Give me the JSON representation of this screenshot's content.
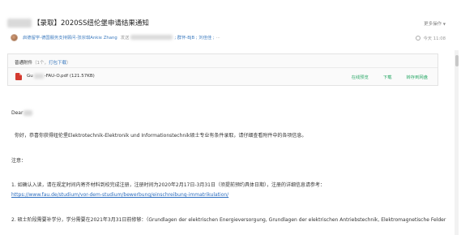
{
  "email": {
    "subject": "【录取】2020SS纽伦堡申请结果通知",
    "more_label": "更多操作",
    "sender_name": "启德留学-德国服务支持顾问-张宗琪Ankie Zhang",
    "to_label": "发送",
    "recipients_visible": "; 群怀-BJB ; 刘佳佳 ;",
    "recipients_more": "...",
    "date": "今天 11:08"
  },
  "attachments": {
    "title": "普通附件",
    "count_text": "（1个，",
    "open_all": "打包下载",
    "count_close": "）",
    "file_prefix": "Gu",
    "file_suffix": "-FAU-O.pdf (121.57KB)",
    "actions": [
      "在线预览",
      "下载",
      "转存到网盘"
    ]
  },
  "body": {
    "greeting": "Dear",
    "para1": "你好，恭喜你获得纽伦堡Elektrotechnik-Elektronik und Informationstechnik硕士专业有条件录取，请仔细查看附件中的各项信息。",
    "para2": "注意：",
    "para3": "1. 如确认入读，请在规定时间内寄齐材料到校完成注册，注册时间为2020年2月17日-3月31日（须提前预约具体日期），注册的详细信息请参考：",
    "link": "https://www.fau.de/studium/vor-dem-studium/bewerbung/einschreibung-immatrikulation/",
    "para4": "2. 硕士阶段需要补学分，学分需要在2021年3月31日前修够：（Grundlagen der elektrischen  Energieversorgung, Grundlagen der elektrischen Antriebstechnik, Elektromagnetische Felder"
  },
  "colors": {
    "link": "#2b6dbf",
    "sender": "#3d7bbf",
    "action": "#2eaa6a",
    "pdf": "#d33a2f"
  },
  "icons": [
    "avatar",
    "clock-icon",
    "pdf-icon",
    "caret-down-icon"
  ]
}
